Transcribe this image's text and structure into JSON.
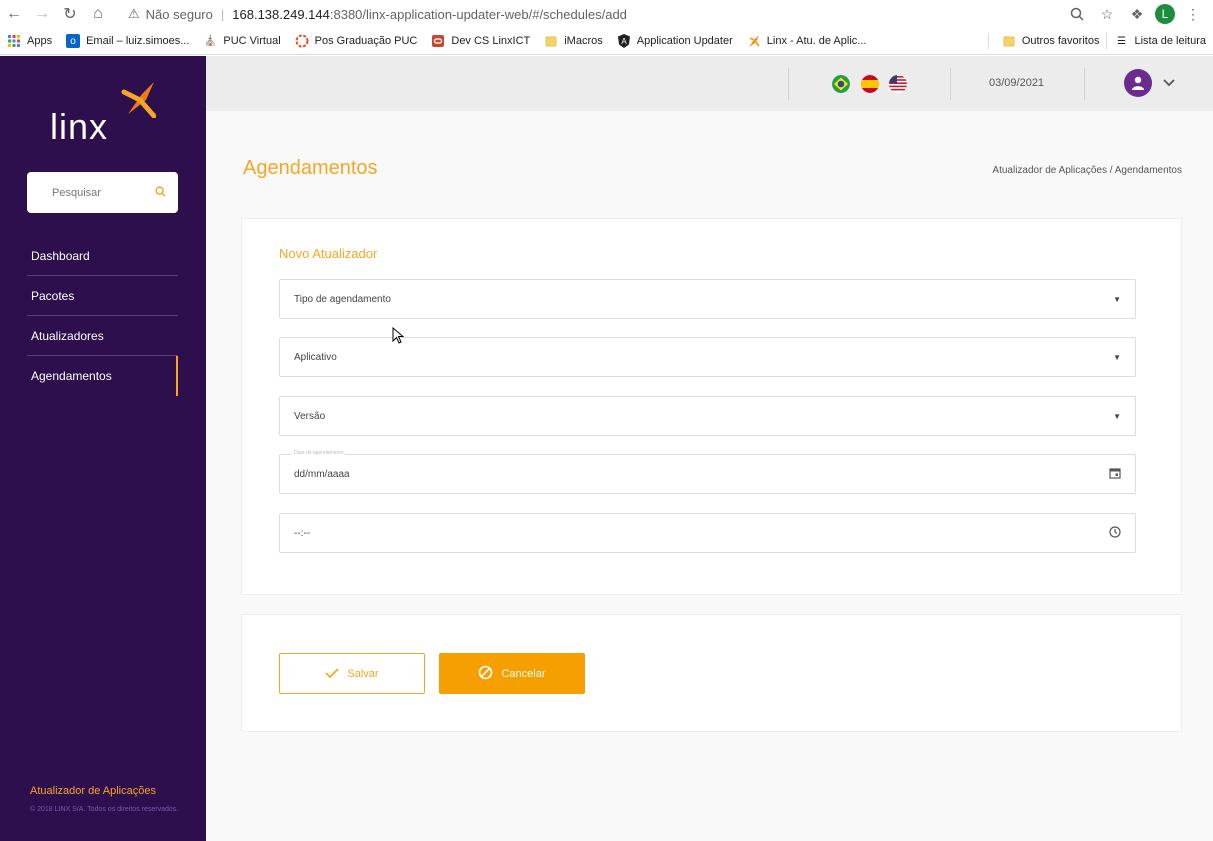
{
  "browser": {
    "security_label": "Não seguro",
    "url_host": "168.138.249.144",
    "url_path": ":8380/linx-application-updater-web/#/schedules/add",
    "profile_initial": "L"
  },
  "bookmarks": {
    "items": [
      {
        "label": "Apps",
        "icon": "apps-icon"
      },
      {
        "label": "Email – luiz.simoes...",
        "icon": "outlook-icon"
      },
      {
        "label": "PUC Virtual",
        "icon": "puc-icon"
      },
      {
        "label": "Pos Graduação PUC",
        "icon": "ring-icon"
      },
      {
        "label": "Dev CS LinxICT",
        "icon": "oracle-icon"
      },
      {
        "label": "iMacros",
        "icon": "folder-icon"
      },
      {
        "label": "Application Updater",
        "icon": "angular-icon"
      },
      {
        "label": "Linx - Atu. de Aplic...",
        "icon": "linx-icon"
      }
    ],
    "other_favorites": "Outros favoritos",
    "reading_list": "Lista de leitura"
  },
  "sidebar": {
    "logo_text": "linx",
    "search_placeholder": "Pesquisar",
    "menu": [
      {
        "label": "Dashboard"
      },
      {
        "label": "Pacotes"
      },
      {
        "label": "Atualizadores"
      },
      {
        "label": "Agendamentos"
      }
    ],
    "footer_title": "Atualizador de Aplicações",
    "footer_copy": "© 2018 LINX S/A. Todos os direitos reservados."
  },
  "topbar": {
    "date": "03/09/2021",
    "languages": [
      "pt-BR",
      "es",
      "en-US"
    ]
  },
  "main": {
    "page_title": "Agendamentos",
    "breadcrumb": "Atualizador de Aplicações / Agendamentos",
    "form_title": "Novo Atualizador",
    "fields": {
      "tipo": "Tipo de agendamento",
      "aplicativo": "Aplicativo",
      "versao": "Versão",
      "data_label": "Data de agendamento",
      "data_placeholder": "dd/mm/aaaa",
      "hora_placeholder": "--:--"
    },
    "buttons": {
      "save": "Salvar",
      "cancel": "Cancelar"
    }
  },
  "colors": {
    "accent": "#f5a623",
    "sidebar": "#2d0f4e"
  }
}
